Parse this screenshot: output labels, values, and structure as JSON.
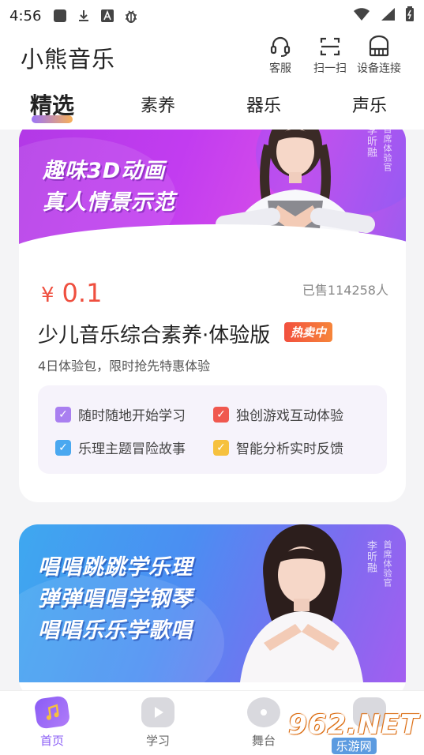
{
  "status_bar": {
    "time": "4:56",
    "left_icons": [
      "square-icon",
      "download-icon",
      "a-box-icon",
      "bug-icon"
    ],
    "right_icons": [
      "wifi-icon",
      "signal-icon",
      "battery-icon"
    ]
  },
  "header": {
    "title": "小熊音乐",
    "actions": [
      {
        "icon": "headset-icon",
        "label": "客服"
      },
      {
        "icon": "scan-icon",
        "label": "扫一扫"
      },
      {
        "icon": "piano-icon",
        "label": "设备连接"
      }
    ]
  },
  "tabs": [
    {
      "label": "精选",
      "active": true
    },
    {
      "label": "素养",
      "active": false
    },
    {
      "label": "器乐",
      "active": false
    },
    {
      "label": "声乐",
      "active": false
    }
  ],
  "card1": {
    "banner": {
      "line1": "趣味3D动画",
      "line2": "真人情景示范",
      "badge_name": "李昕融",
      "badge_role": "首席体验官"
    },
    "price_symbol": "¥",
    "price": "0.1",
    "sold": "已售114258人",
    "title": "少儿音乐综合素养·体验版",
    "hot_badge": "热卖中",
    "subtitle": "4日体验包，限时抢先特惠体验",
    "features": [
      {
        "label": "随时随地开始学习",
        "color": "#a97ff0"
      },
      {
        "label": "独创游戏互动体验",
        "color": "#f0584f"
      },
      {
        "label": "乐理主题冒险故事",
        "color": "#4aa8f0"
      },
      {
        "label": "智能分析实时反馈",
        "color": "#f6c13e"
      }
    ]
  },
  "card2": {
    "banner": {
      "line1": "唱唱跳跳学乐理",
      "line2": "弹弹唱唱学钢琴",
      "line3": "唱唱乐乐学歌唱",
      "badge_name": "李昕融",
      "badge_role": "首席体验官"
    }
  },
  "bottom_nav": [
    {
      "label": "首页",
      "icon": "home-music-icon",
      "active": true
    },
    {
      "label": "学习",
      "icon": "study-play-icon",
      "active": false
    },
    {
      "label": "舞台",
      "icon": "stage-disc-icon",
      "active": false
    },
    {
      "label": "",
      "icon": "profile-bear-icon",
      "active": false
    }
  ],
  "watermark": {
    "main": "962.NET",
    "sub": "乐游网"
  },
  "colors": {
    "accent": "#8a5cf6",
    "price": "#ef4f3f",
    "banner1": "#c23cf0",
    "banner2": "#4b8ef2"
  }
}
